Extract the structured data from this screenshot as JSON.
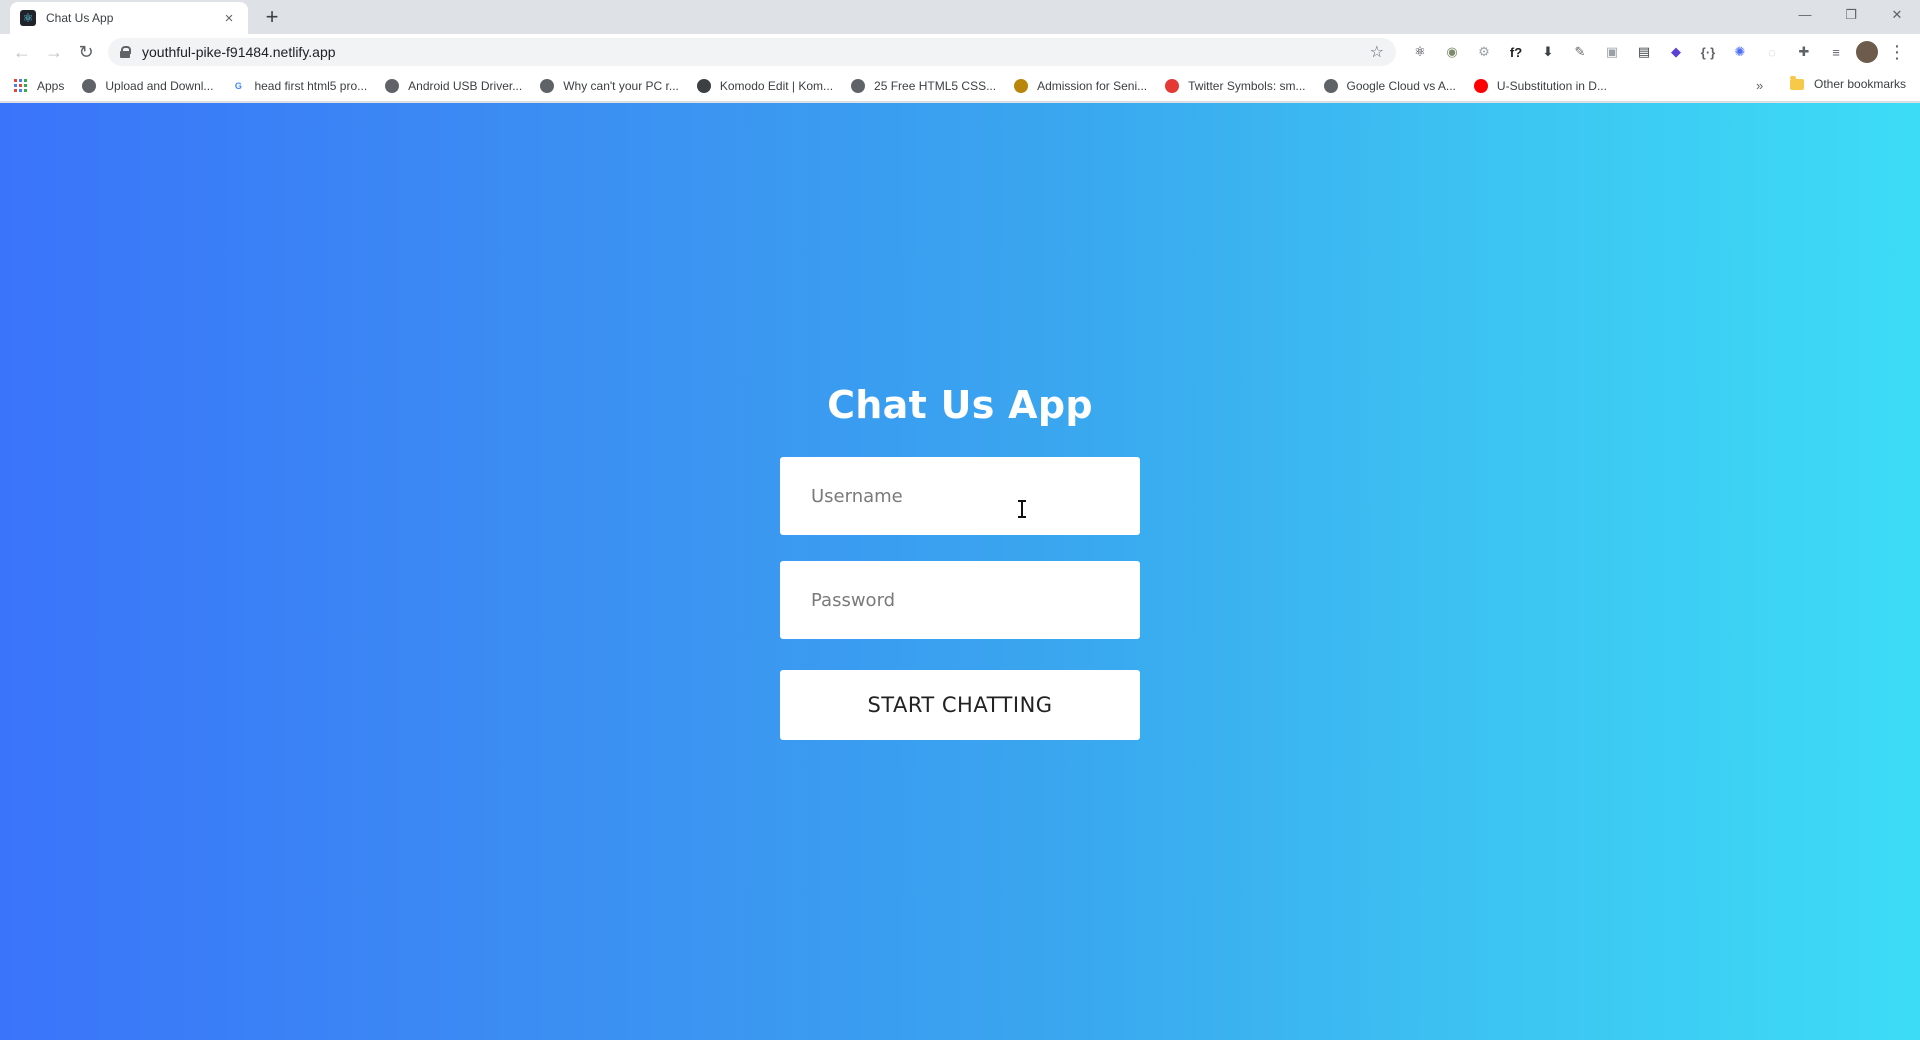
{
  "browser": {
    "tab": {
      "title": "Chat Us App",
      "favicon": "react-icon",
      "close": "×"
    },
    "new_tab": "+",
    "window_controls": {
      "minimize": "—",
      "restore": "❐",
      "close": "✕"
    },
    "nav": {
      "back": "←",
      "forward": "→",
      "reload": "↻"
    },
    "url": "youthful-pike-f91484.netlify.app",
    "star": "☆",
    "extensions": [
      {
        "name": "react-devtools-icon",
        "glyph": "⚛",
        "color": "#20232a"
      },
      {
        "name": "extension-globe-icon",
        "glyph": "◉",
        "color": "#7d8b6a"
      },
      {
        "name": "extension-wheel-icon",
        "glyph": "⚙",
        "color": "#9aa0a6"
      },
      {
        "name": "font-finder-icon",
        "glyph": "f?",
        "color": "#202124"
      },
      {
        "name": "download-icon",
        "glyph": "⬇",
        "color": "#3c4043"
      },
      {
        "name": "color-picker-icon",
        "glyph": "✎",
        "color": "#5f6368"
      },
      {
        "name": "extension-grey-icon",
        "glyph": "▣",
        "color": "#9aa0a6"
      },
      {
        "name": "reader-icon",
        "glyph": "▤",
        "color": "#3c4043"
      },
      {
        "name": "extension-purple-icon",
        "glyph": "◆",
        "color": "#5b3fd6"
      },
      {
        "name": "json-viewer-icon",
        "glyph": "{·}",
        "color": "#5f6368"
      },
      {
        "name": "extension-gear-badge-icon",
        "glyph": "✺",
        "color": "#4c6ef5"
      },
      {
        "name": "extension-circle-icon",
        "glyph": "◌",
        "color": "#bdc1c6"
      },
      {
        "name": "extensions-puzzle-icon",
        "glyph": "✚",
        "color": "#5f6368"
      },
      {
        "name": "media-control-icon",
        "glyph": "≡",
        "color": "#5f6368"
      }
    ],
    "menu": "⋮",
    "bookmarks": [
      {
        "label": "Apps",
        "icon": "apps-grid-icon"
      },
      {
        "label": "Upload and Downl...",
        "icon": "globe-icon",
        "color": "#5f6368"
      },
      {
        "label": "head first html5 pro...",
        "icon": "google-icon",
        "color": "#4285f4",
        "glyph": "G"
      },
      {
        "label": "Android USB Driver...",
        "icon": "globe-icon",
        "color": "#5f6368"
      },
      {
        "label": "Why can't your PC r...",
        "icon": "globe-icon",
        "color": "#5f6368"
      },
      {
        "label": "Komodo Edit | Kom...",
        "icon": "komodo-icon",
        "color": "#3c4043"
      },
      {
        "label": "25 Free HTML5 CSS...",
        "icon": "globe-icon",
        "color": "#5f6368"
      },
      {
        "label": "Admission for Seni...",
        "icon": "school-icon",
        "color": "#b8860b"
      },
      {
        "label": "Twitter Symbols: sm...",
        "icon": "lightning-icon",
        "color": "#e53935"
      },
      {
        "label": "Google Cloud vs A...",
        "icon": "globe-icon",
        "color": "#5f6368"
      },
      {
        "label": "U-Substitution in D...",
        "icon": "youtube-icon",
        "color": "#ff0000"
      }
    ],
    "bookmarks_overflow": "»",
    "other_bookmarks": "Other bookmarks"
  },
  "page": {
    "title": "Chat Us App",
    "username_placeholder": "Username",
    "password_placeholder": "Password",
    "start_button": "START CHATTING"
  }
}
